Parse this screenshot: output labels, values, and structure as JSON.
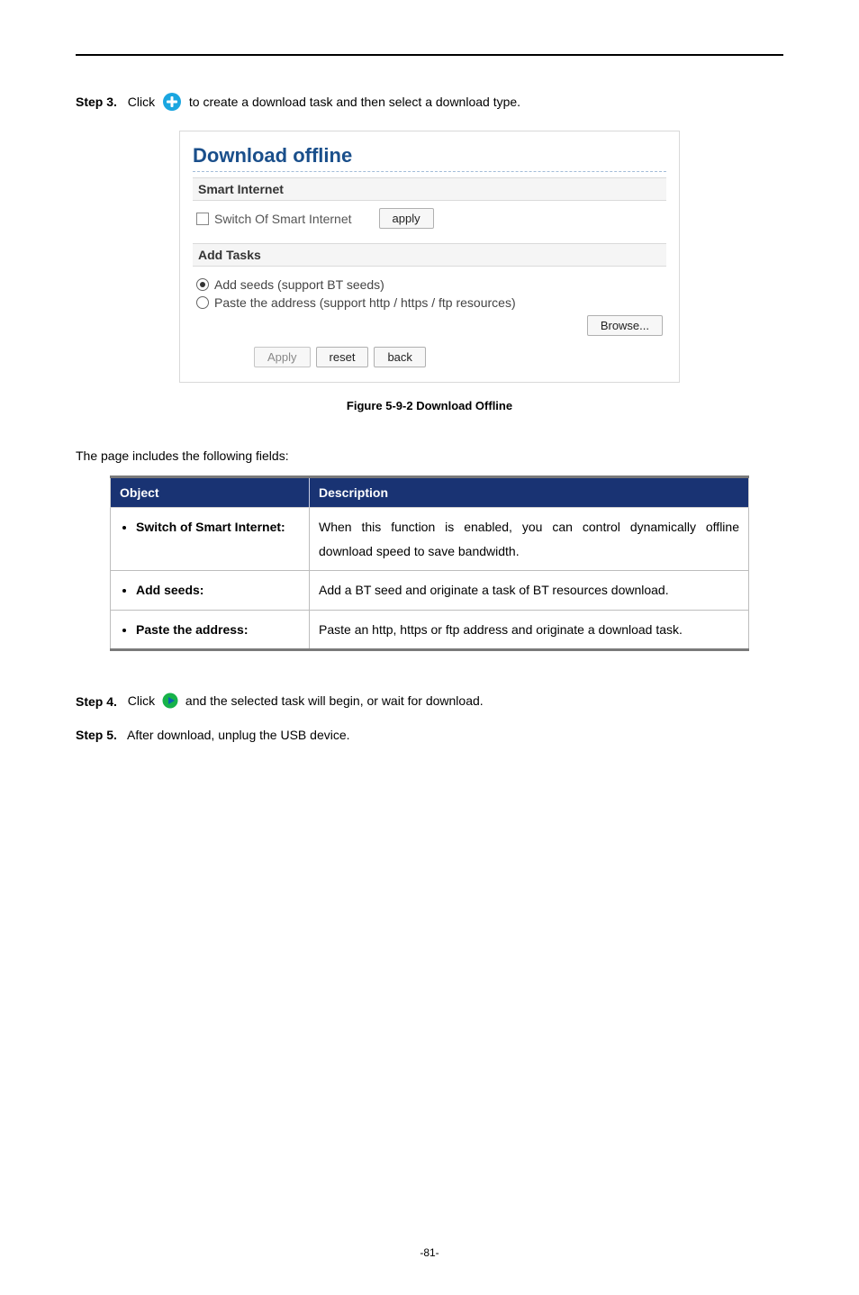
{
  "steps": {
    "s3": {
      "label": "Step 3.",
      "pre": "Click ",
      "post": " to create a download task and then select a download type."
    },
    "s4": {
      "label": "Step 4.",
      "pre": "Click ",
      "post": " and the selected task will begin, or wait for download."
    },
    "s5": {
      "label": "Step 5.",
      "text": "After download, unplug the USB device."
    }
  },
  "screenshot": {
    "title": "Download offline",
    "section1": "Smart Internet",
    "switch_label": "Switch Of Smart Internet",
    "apply": "apply",
    "section2": "Add Tasks",
    "radio1": "Add seeds (support BT seeds)",
    "radio2": "Paste the address (support http / https / ftp resources)",
    "browse": "Browse...",
    "btn_apply": "Apply",
    "btn_reset": "reset",
    "btn_back": "back"
  },
  "figure_caption": "Figure 5-9-2 Download Offline",
  "intro_line": "The page includes the following fields:",
  "table": {
    "headers": [
      "Object",
      "Description"
    ],
    "rows": [
      {
        "obj": "Switch of Smart Internet:",
        "desc": "When this function is enabled, you can control dynamically offline download speed to save bandwidth."
      },
      {
        "obj": "Add seeds:",
        "desc": "Add a BT seed and originate a task of BT resources download."
      },
      {
        "obj": "Paste the address:",
        "desc": "Paste an http, https or ftp address and originate a download task."
      }
    ]
  },
  "page_number": "-81-"
}
